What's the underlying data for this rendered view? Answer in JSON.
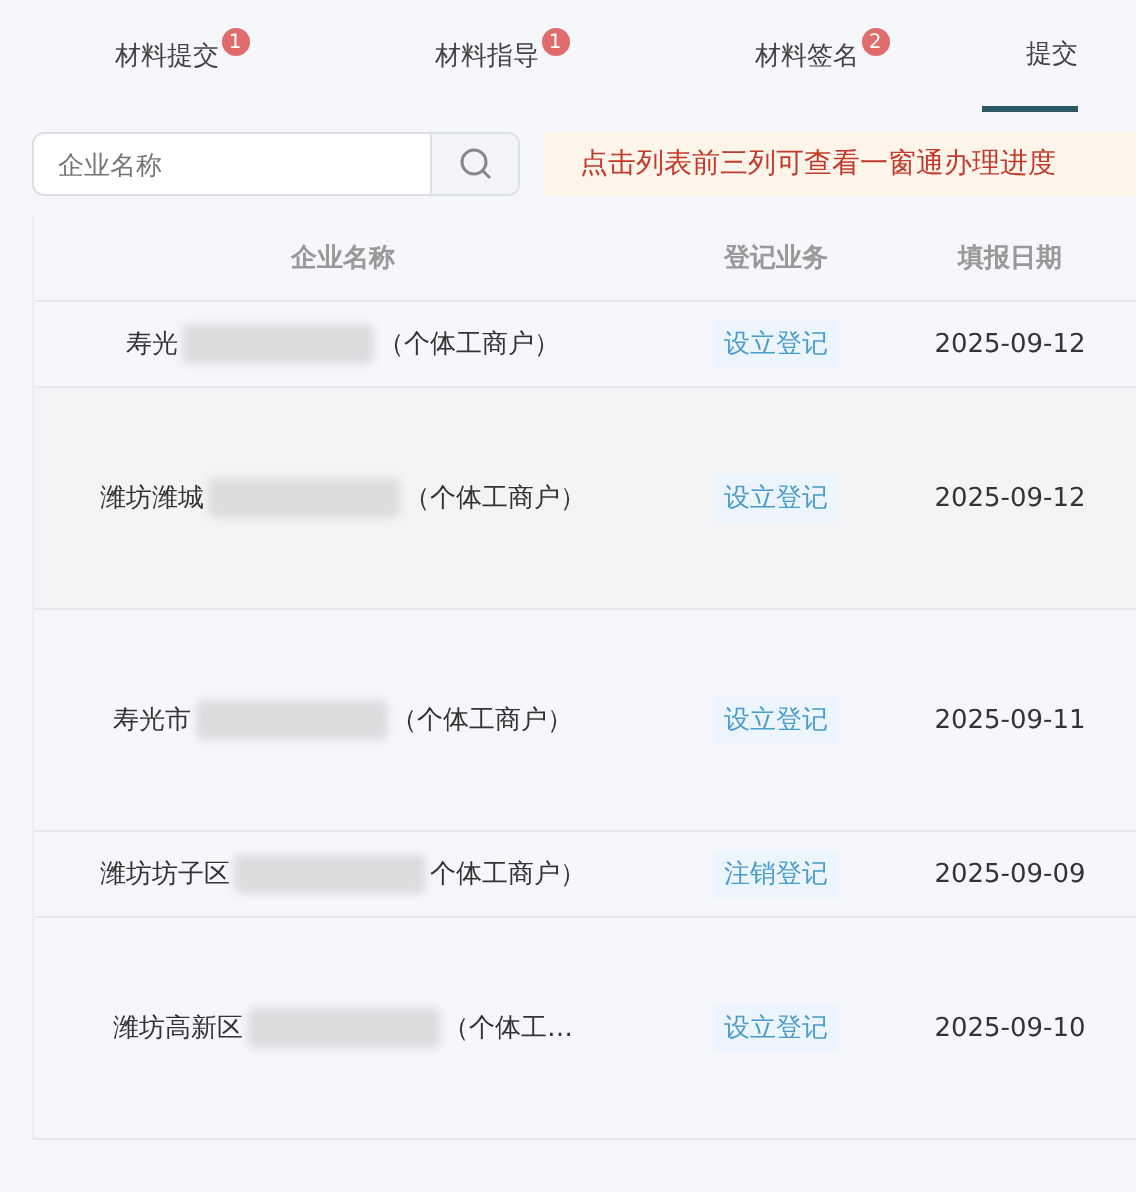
{
  "tabs": [
    {
      "label": "材料提交",
      "badge": "1",
      "selected": false
    },
    {
      "label": "材料指导",
      "badge": "1",
      "selected": false
    },
    {
      "label": "材料签名",
      "badge": "2",
      "selected": false
    },
    {
      "label": "提交",
      "selected": true
    }
  ],
  "search": {
    "placeholder": "企业名称"
  },
  "notice": "点击列表前三列可查看一窗通办理进度",
  "table": {
    "columns": [
      "企业名称",
      "登记业务",
      "填报日期"
    ],
    "rows": [
      {
        "name_start": "寿光",
        "name_end": "（个体工商户）",
        "business": "设立登记",
        "date": "2025-09-12"
      },
      {
        "name_start": "潍坊潍城",
        "name_end": "（个体工商户）",
        "business": "设立登记",
        "date": "2025-09-12"
      },
      {
        "name_start": "寿光市",
        "name_end": "（个体工商户）",
        "business": "设立登记",
        "date": "2025-09-11"
      },
      {
        "name_start": "潍坊坊子区",
        "name_end": "个体工商户）",
        "business": "注销登记",
        "date": "2025-09-09"
      },
      {
        "name_start": "潍坊高新区",
        "name_end": "（个体工…",
        "business": "设立登记",
        "date": "2025-09-10"
      }
    ]
  }
}
